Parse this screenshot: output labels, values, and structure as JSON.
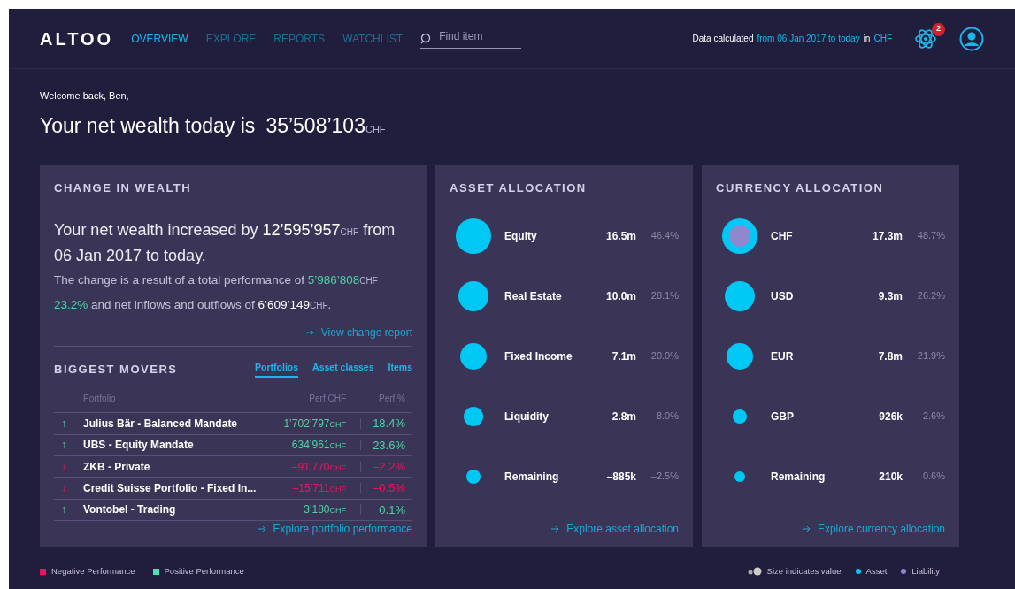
{
  "header": {
    "logo": "ALTOO",
    "nav": [
      {
        "label": "OVERVIEW",
        "selected": true
      },
      {
        "label": "EXPLORE",
        "selected": false
      },
      {
        "label": "REPORTS",
        "selected": false
      },
      {
        "label": "WATCHLIST",
        "selected": false
      }
    ],
    "search": {
      "placeholder": "Find item"
    },
    "calc": [
      {
        "text": "Data calculated",
        "kind": "plain"
      },
      {
        "text": "from 06 Jan 2017 to today",
        "kind": "link"
      },
      {
        "text": "in",
        "kind": "plain"
      },
      {
        "text": "CHF",
        "kind": "link"
      }
    ],
    "notifications": "2"
  },
  "welcome": "Welcome back, Ben,",
  "net_wealth": {
    "label": "Your net wealth today is",
    "amount": "35’508’103",
    "unit": "CHF"
  },
  "change": {
    "title": "CHANGE IN WEALTH",
    "headline": [
      {
        "kind": "text",
        "text": "Your net wealth increased by "
      },
      {
        "kind": "amount",
        "text": "12’595’957"
      },
      {
        "kind": "unit",
        "text": "CHF"
      },
      {
        "kind": "text",
        "text": " from 06 Jan 2017 to today."
      }
    ],
    "detail": [
      {
        "kind": "text",
        "text": "The change is a result of a total performance of "
      },
      {
        "kind": "positive",
        "text": "5’986’808"
      },
      {
        "kind": "unit",
        "text": "CHF"
      },
      {
        "kind": "positive",
        "text": " 23.2%"
      },
      {
        "kind": "text",
        "text": " and net inflows and outflows of "
      },
      {
        "kind": "amount",
        "text": "6’609’149"
      },
      {
        "kind": "unit",
        "text": "CHF"
      },
      {
        "kind": "text",
        "text": "."
      }
    ],
    "link": "View change report"
  },
  "movers": {
    "title": "BIGGEST MOVERS",
    "tabs": [
      {
        "label": "Portfolios",
        "selected": true
      },
      {
        "label": "Asset classes",
        "selected": false
      },
      {
        "label": "Items",
        "selected": false
      }
    ],
    "columns": [
      "Portfolio",
      "Perf CHF",
      "Perf %"
    ],
    "rows": [
      {
        "kind": "gain",
        "arrow": "↑",
        "name": "Julius Bär - Balanced Mandate",
        "perf": "1’702’797",
        "unit": "CHF",
        "pct": "18.4%"
      },
      {
        "kind": "gain",
        "arrow": "↑",
        "name": "UBS - Equity Mandate",
        "perf": "634’961",
        "unit": "CHF",
        "pct": "23.6%"
      },
      {
        "kind": "loss",
        "arrow": "↓",
        "name": "ZKB - Private",
        "perf": "–91’770",
        "unit": "CHF",
        "pct": "–2.2%"
      },
      {
        "kind": "loss",
        "arrow": "↓",
        "name": "Credit Suisse Portfolio - Fixed In...",
        "perf": "–15’711",
        "unit": "CHF",
        "pct": "–0.5%"
      },
      {
        "kind": "gain",
        "arrow": "↑",
        "name": "Vontobel - Trading",
        "perf": "3’180",
        "unit": "CHF",
        "pct": "0.1%"
      }
    ],
    "link": "Explore portfolio performance"
  },
  "allocations": [
    {
      "title": "ASSET ALLOCATION",
      "link": "Explore asset allocation",
      "items": [
        {
          "name": "Equity",
          "value": "16.5m",
          "pct": "46.4%",
          "kind": "xl",
          "liability": false
        },
        {
          "name": "Real Estate",
          "value": "10.0m",
          "pct": "28.1%",
          "kind": "l",
          "liability": false
        },
        {
          "name": "Fixed Income",
          "value": "7.1m",
          "pct": "20.0%",
          "kind": "m",
          "liability": false
        },
        {
          "name": "Liquidity",
          "value": "2.8m",
          "pct": "8.0%",
          "kind": "s",
          "liability": false
        },
        {
          "name": "Remaining",
          "value": "–885k",
          "pct": "–2.5%",
          "kind": "xs",
          "liability": false
        }
      ]
    },
    {
      "title": "CURRENCY ALLOCATION",
      "link": "Explore currency allocation",
      "items": [
        {
          "name": "CHF",
          "value": "17.3m",
          "pct": "48.7%",
          "kind": "xl",
          "liability": true
        },
        {
          "name": "USD",
          "value": "9.3m",
          "pct": "26.2%",
          "kind": "l",
          "liability": false
        },
        {
          "name": "EUR",
          "value": "7.8m",
          "pct": "21.9%",
          "kind": "m",
          "liability": false
        },
        {
          "name": "GBP",
          "value": "926k",
          "pct": "2.6%",
          "kind": "xs",
          "liability": false
        },
        {
          "name": "Remaining",
          "value": "210k",
          "pct": "0.6%",
          "kind": "xxs",
          "liability": false
        }
      ]
    }
  ],
  "legend_left": [
    {
      "label": "Negative Performance",
      "color": "#e8175d"
    },
    {
      "label": "Positive Performance",
      "color": "#4fe0b0"
    }
  ],
  "legend_right": [
    {
      "kind": "size",
      "label": "Size indicates value"
    },
    {
      "kind": "dot",
      "label": "Asset",
      "color": "#00c8f5"
    },
    {
      "kind": "dot",
      "label": "Liability",
      "color": "#8f86cc"
    }
  ]
}
